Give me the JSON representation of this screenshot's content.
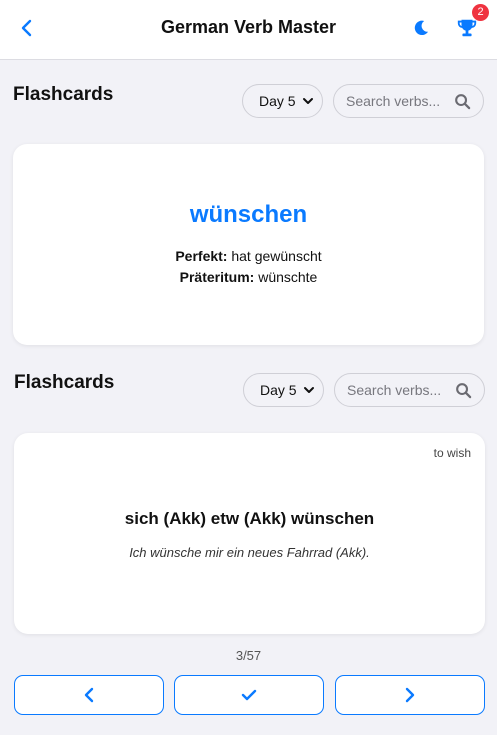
{
  "header": {
    "title": "German Verb Master",
    "back_icon": "chevron-left-icon",
    "theme_icon": "moon-icon",
    "trophy_icon": "trophy-icon",
    "trophy_badge": "2",
    "accent": "#0a7aff"
  },
  "section1": {
    "title": "Flashcards",
    "day_select": "Day 5",
    "search_placeholder": "Search verbs..."
  },
  "card1": {
    "verb": "wünschen",
    "perfekt_label": "Perfekt:",
    "perfekt_value": "hat gewünscht",
    "praeteritum_label": "Präteritum:",
    "praeteritum_value": "wünschte"
  },
  "section2": {
    "title": "Flashcards",
    "day_select": "Day 5",
    "search_placeholder": "Search verbs..."
  },
  "card2": {
    "meaning": "to wish",
    "phrase": "sich (Akk) etw (Akk) wünschen",
    "example": "Ich wünsche mir ein neues Fahrrad (Akk)."
  },
  "navigation": {
    "counter": "3/57",
    "prev_icon": "chevron-left-icon",
    "check_icon": "check-icon",
    "next_icon": "chevron-right-icon"
  }
}
